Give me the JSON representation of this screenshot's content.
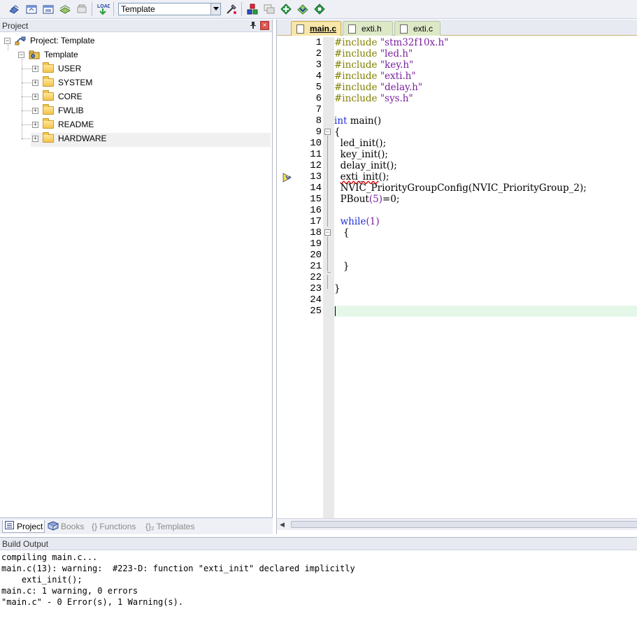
{
  "toolbar": {
    "target_value": "Template",
    "load_label": "LOAD"
  },
  "project_panel": {
    "title": "Project",
    "root_label": "Project: Template",
    "target_label": "Template",
    "groups": [
      "USER",
      "SYSTEM",
      "CORE",
      "FWLIB",
      "README",
      "HARDWARE"
    ],
    "tabs": [
      {
        "label": "Project",
        "icon": "project-icon"
      },
      {
        "label": "Books",
        "icon": "books-icon"
      },
      {
        "label": "{} Functions",
        "icon": "functions-icon"
      },
      {
        "label": "{}₂ Templates",
        "icon": "templates-icon"
      }
    ]
  },
  "editor": {
    "tabs": [
      "main.c",
      "exti.h",
      "exti.c"
    ],
    "active_tab": "main.c",
    "line_numbers": [
      "1",
      "2",
      "3",
      "4",
      "5",
      "6",
      "7",
      "8",
      "9",
      "10",
      "11",
      "12",
      "13",
      "14",
      "15",
      "16",
      "17",
      "18",
      "19",
      "20",
      "21",
      "22",
      "23",
      "24",
      "25"
    ],
    "code": {
      "l1_pp": "#include",
      "l1_str": "\"stm32f10x.h\"",
      "l2_pp": "#include",
      "l2_str": "\"led.h\"",
      "l3_pp": "#include",
      "l3_str": "\"key.h\"",
      "l4_pp": "#include",
      "l4_str": "\"exti.h\"",
      "l5_pp": "#include",
      "l5_str": "\"delay.h\"",
      "l6_pp": "#include",
      "l6_str": "\"sys.h\"",
      "l8_kw": "int",
      "l8_rest": " main()",
      "l9": "{",
      "l10": "  led_init();",
      "l11": "  key_init();",
      "l12": "  delay_init();",
      "l13_call": "exti_init",
      "l13_rest": "();",
      "l14": "  NVIC_PriorityGroupConfig(NVIC_PriorityGroup_2);",
      "l15_a": "  PBout",
      "l15_b": "(5)",
      "l15_c": "=0;",
      "l17_kw": "while",
      "l17_b": "(1)",
      "l18": "   {",
      "l21": "   }",
      "l23": "}"
    }
  },
  "build_output": {
    "title": "Build Output",
    "lines": [
      "compiling main.c...",
      "main.c(13): warning:  #223-D: function \"exti_init\" declared implicitly",
      "    exti_init();",
      "main.c: 1 warning, 0 errors",
      "\"main.c\" - 0 Error(s), 1 Warning(s)."
    ]
  },
  "colors": {
    "preprocessor": "#808000",
    "string": "#7a1fa0",
    "keyword": "#1f2fd8",
    "current_line": "#e5f7e8",
    "active_tab": "#f8e5a8",
    "inactive_tab": "#dde8c6"
  }
}
